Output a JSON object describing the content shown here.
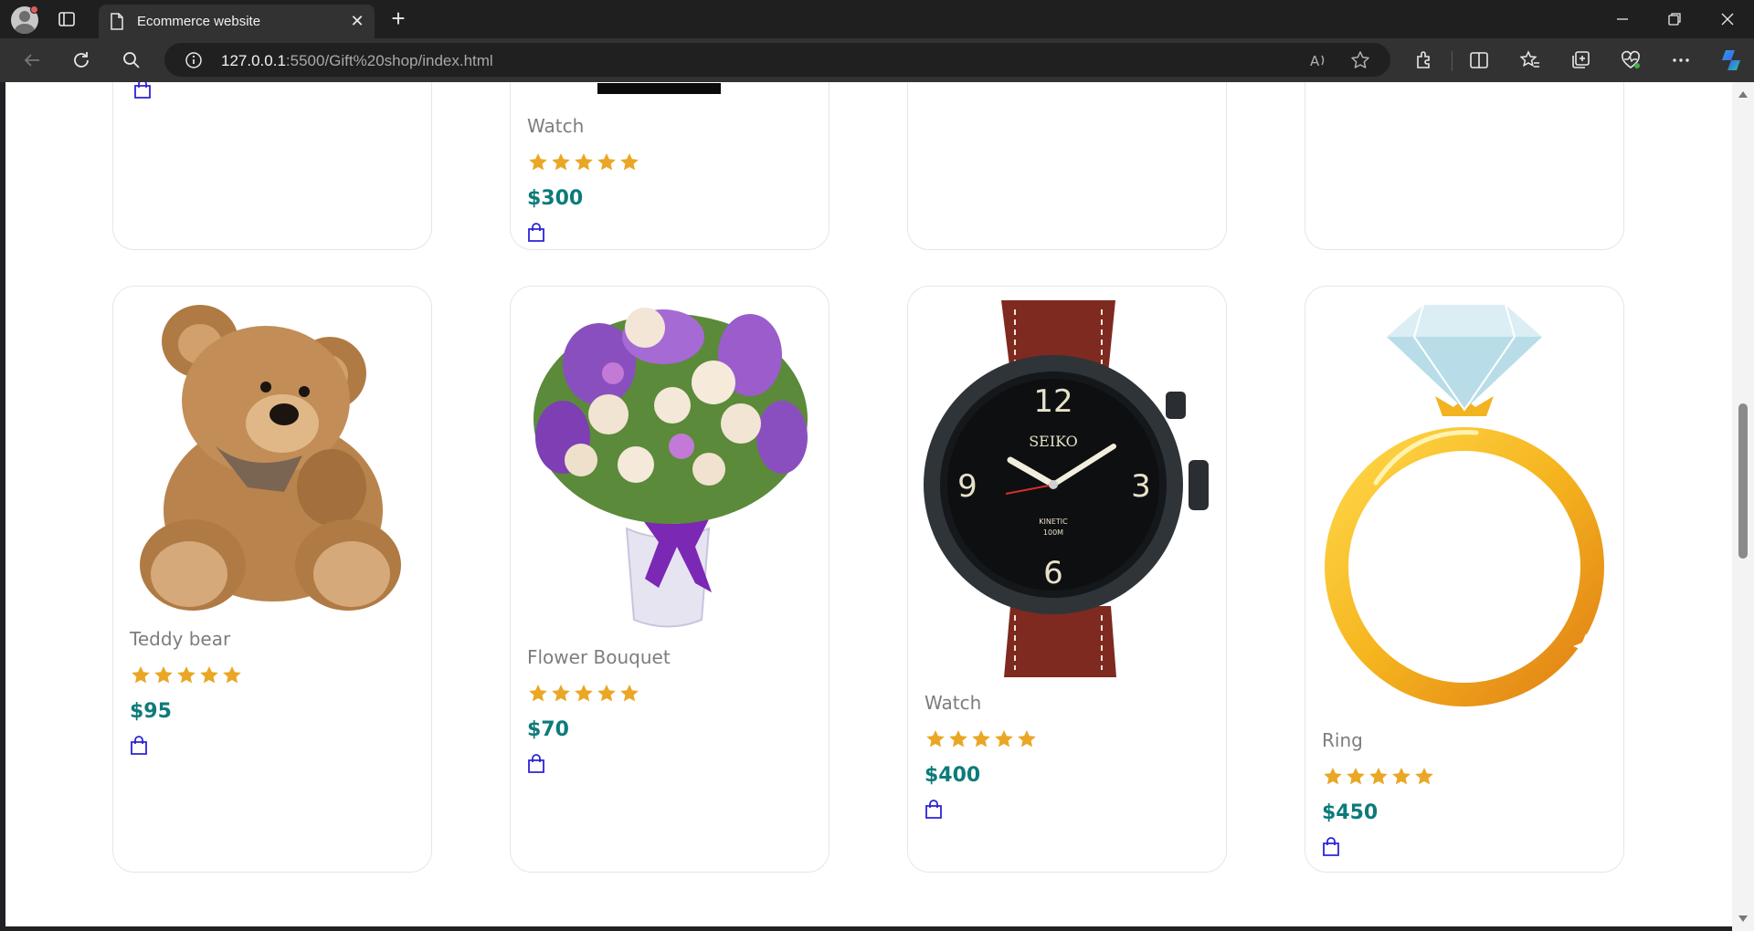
{
  "browser": {
    "tab_title": "Ecommerce website",
    "url_host": "127.0.0.1",
    "url_rest": ":5500/Gift%20shop/index.html",
    "icons": [
      "profile-avatar",
      "tab-actions-icon",
      "page-icon",
      "close-icon",
      "plus-icon",
      "minimize-icon",
      "restore-icon",
      "window-close-icon",
      "back-arrow-icon",
      "refresh-icon",
      "search-icon",
      "site-info-icon",
      "read-aloud-icon",
      "favorite-star-icon",
      "extensions-icon",
      "split-screen-icon",
      "favorites-icon",
      "collections-icon",
      "browser-essentials-icon",
      "more-icon",
      "copilot-icon"
    ]
  },
  "colors": {
    "price": "#0c7b7a",
    "star": "#e9a725",
    "bag": "#2b23d8",
    "name": "#7d7d7d"
  },
  "top_row": {
    "visible_product": {
      "name": "Watch",
      "price": "$300",
      "rating": 5
    }
  },
  "products": [
    {
      "name": "Teddy bear",
      "price": "$95",
      "rating": 5,
      "image": "teddy-bear"
    },
    {
      "name": "Flower Bouquet",
      "price": "$70",
      "rating": 5,
      "image": "flower-bouquet"
    },
    {
      "name": "Watch",
      "price": "$400",
      "rating": 5,
      "image": "wrist-watch",
      "watch_brand": "SEIKO",
      "watch_dial_text": "KINETIC",
      "watch_depth": "100M",
      "watch_numerals": [
        "12",
        "3",
        "6",
        "9"
      ]
    },
    {
      "name": "Ring",
      "price": "$450",
      "rating": 5,
      "image": "diamond-ring"
    }
  ]
}
